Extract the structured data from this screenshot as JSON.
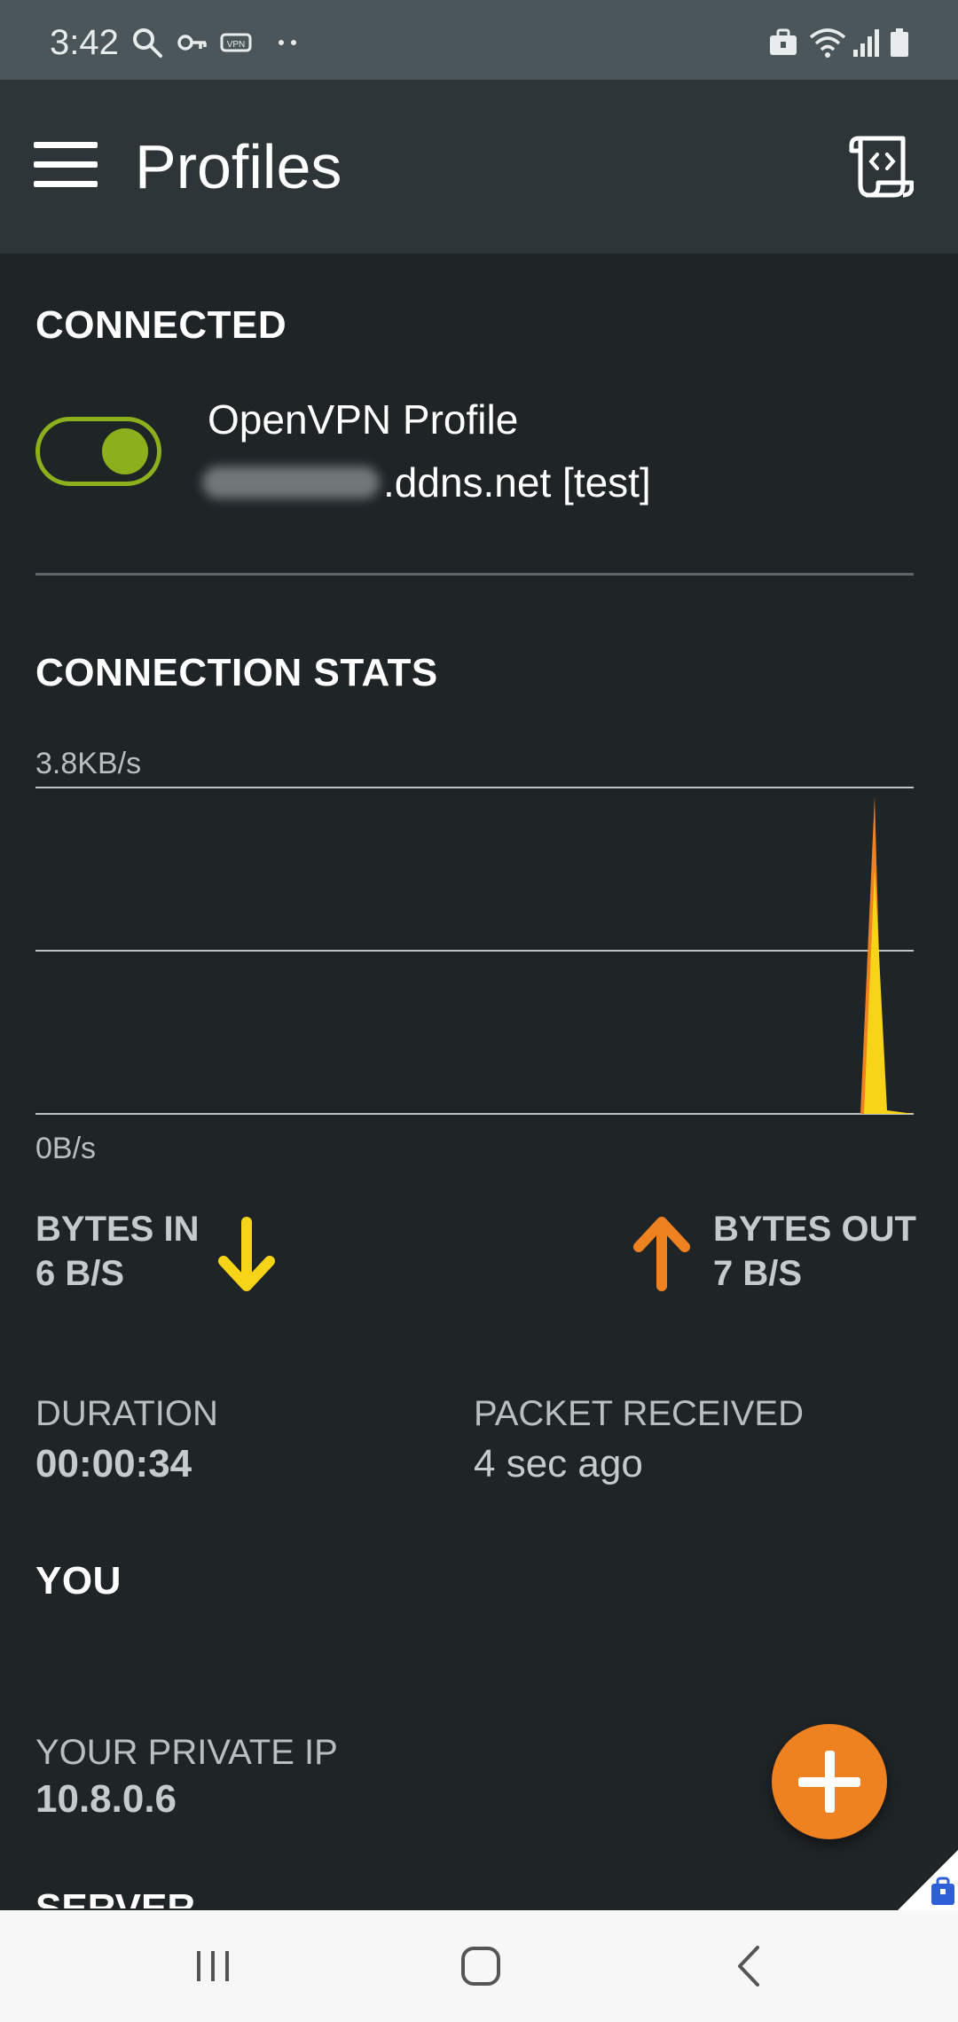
{
  "status_bar": {
    "time": "3:42",
    "icons": [
      "search-icon",
      "key-icon",
      "vpn-icon",
      "more-dots-icon",
      "work-profile-icon",
      "wifi-icon",
      "signal-icon",
      "battery-icon"
    ]
  },
  "app_bar": {
    "title": "Profiles",
    "menu_icon": "hamburger-menu-icon",
    "log_icon": "log-scroll-icon"
  },
  "connected": {
    "section_title": "CONNECTED",
    "toggle_on": true,
    "profile_name": "OpenVPN Profile",
    "profile_host": ".ddns.net [test]"
  },
  "stats": {
    "section_title": "CONNECTION STATS",
    "chart_max_label": "3.8KB/s",
    "chart_min_label": "0B/s",
    "bytes_in_label": "BYTES IN",
    "bytes_in_value": "6 B/S",
    "bytes_out_label": "BYTES OUT",
    "bytes_out_value": "7 B/S",
    "duration_label": "DURATION",
    "duration_value": "00:00:34",
    "packet_label": "PACKET RECEIVED",
    "packet_value": "4 sec ago"
  },
  "you": {
    "section_title": "YOU",
    "private_ip_label": "YOUR PRIVATE IP",
    "private_ip_value": "10.8.0.6"
  },
  "server": {
    "section_title": "SERVER"
  },
  "colors": {
    "accent_green": "#8cb01c",
    "bytes_in_color": "#f7d417",
    "bytes_out_color": "#ee8120",
    "background": "#1f2427",
    "app_bar": "#2e3538"
  },
  "chart_data": {
    "type": "area",
    "ylim_label": [
      "0B/s",
      "3.8KB/s"
    ],
    "series": [
      {
        "color": "#ee8120"
      },
      {
        "color": "#f7d417"
      }
    ]
  }
}
